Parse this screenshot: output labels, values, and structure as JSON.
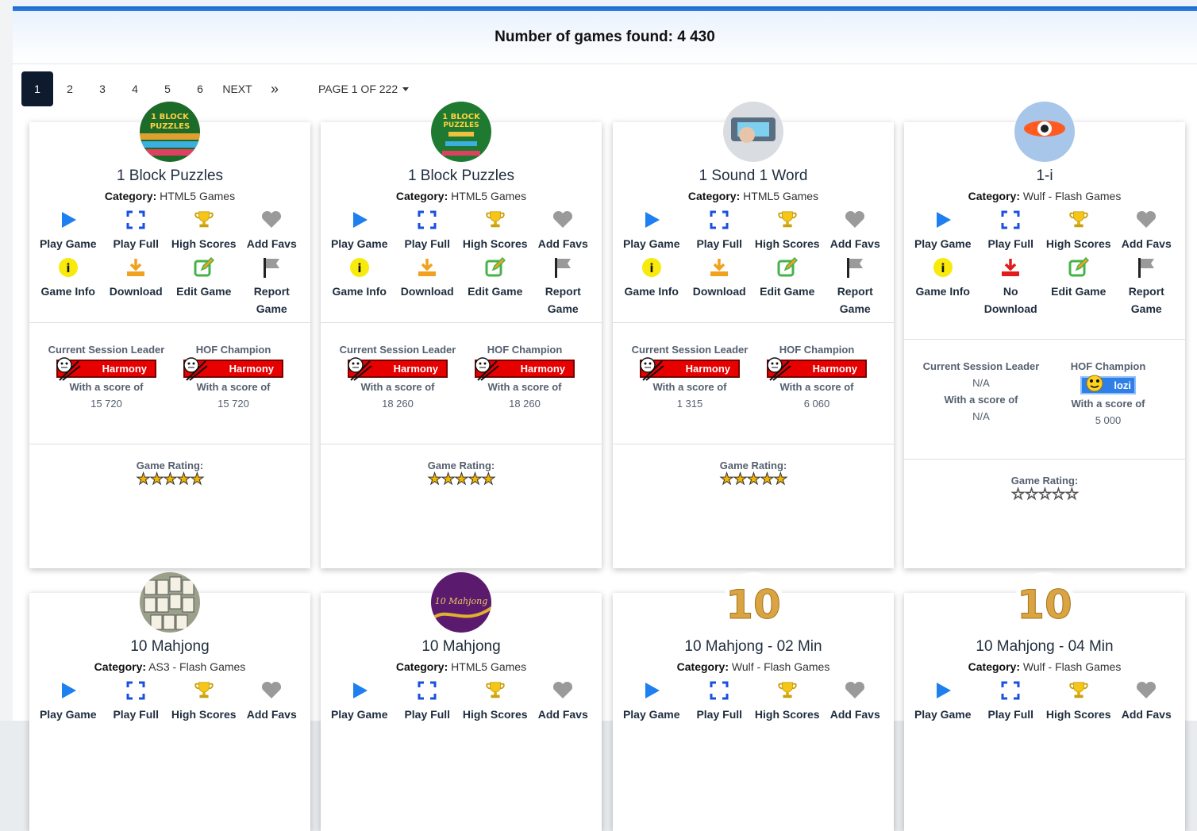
{
  "header": {
    "title": "Number of games found: 4 430"
  },
  "pagination": {
    "pages": [
      "1",
      "2",
      "3",
      "4",
      "5",
      "6"
    ],
    "next": "NEXT",
    "last": "»",
    "page_of": "PAGE 1 OF 222"
  },
  "labels": {
    "category": "Category:",
    "play_game": "Play Game",
    "play_full": "Play Full",
    "high_scores": "High Scores",
    "add_favs": "Add Favs",
    "game_info": "Game Info",
    "download": "Download",
    "no_download": "No Download",
    "edit_game": "Edit Game",
    "report_game": "Report Game",
    "session_leader": "Current Session Leader",
    "hof_champion": "HOF Champion",
    "with_score": "With a score of",
    "game_rating": "Game Rating:",
    "na": "N/A"
  },
  "cards": [
    {
      "title": "1 Block Puzzles",
      "category": "HTML5 Games",
      "session_leader": "Harmony",
      "session_score": "15 720",
      "hof_leader": "Harmony",
      "hof_score": "15 720",
      "rating": 5,
      "download_available": true
    },
    {
      "title": "1 Block Puzzles",
      "category": "HTML5 Games",
      "session_leader": "Harmony",
      "session_score": "18 260",
      "hof_leader": "Harmony",
      "hof_score": "18 260",
      "rating": 5,
      "download_available": true
    },
    {
      "title": "1 Sound 1 Word",
      "category": "HTML5 Games",
      "session_leader": "Harmony",
      "session_score": "1 315",
      "hof_leader": "Harmony",
      "hof_score": "6 060",
      "rating": 5,
      "download_available": true
    },
    {
      "title": "1-i",
      "category": "Wulf - Flash Games",
      "session_leader": "N/A",
      "session_score": "N/A",
      "hof_leader": "lozi",
      "hof_score": "5 000",
      "rating": 0,
      "download_available": false
    },
    {
      "title": "10 Mahjong",
      "category": "AS3 - Flash Games"
    },
    {
      "title": "10 Mahjong",
      "category": "HTML5 Games"
    },
    {
      "title": "10 Mahjong - 02 Min",
      "category": "Wulf - Flash Games"
    },
    {
      "title": "10 Mahjong - 04 Min",
      "category": "Wulf - Flash Games"
    }
  ],
  "colors": {
    "accent": "#1a66c9",
    "badge_red": "#e60000",
    "badge_blue": "#2f7fe6",
    "active_page": "#0e1b2e",
    "star_gold": "#f5b400"
  }
}
